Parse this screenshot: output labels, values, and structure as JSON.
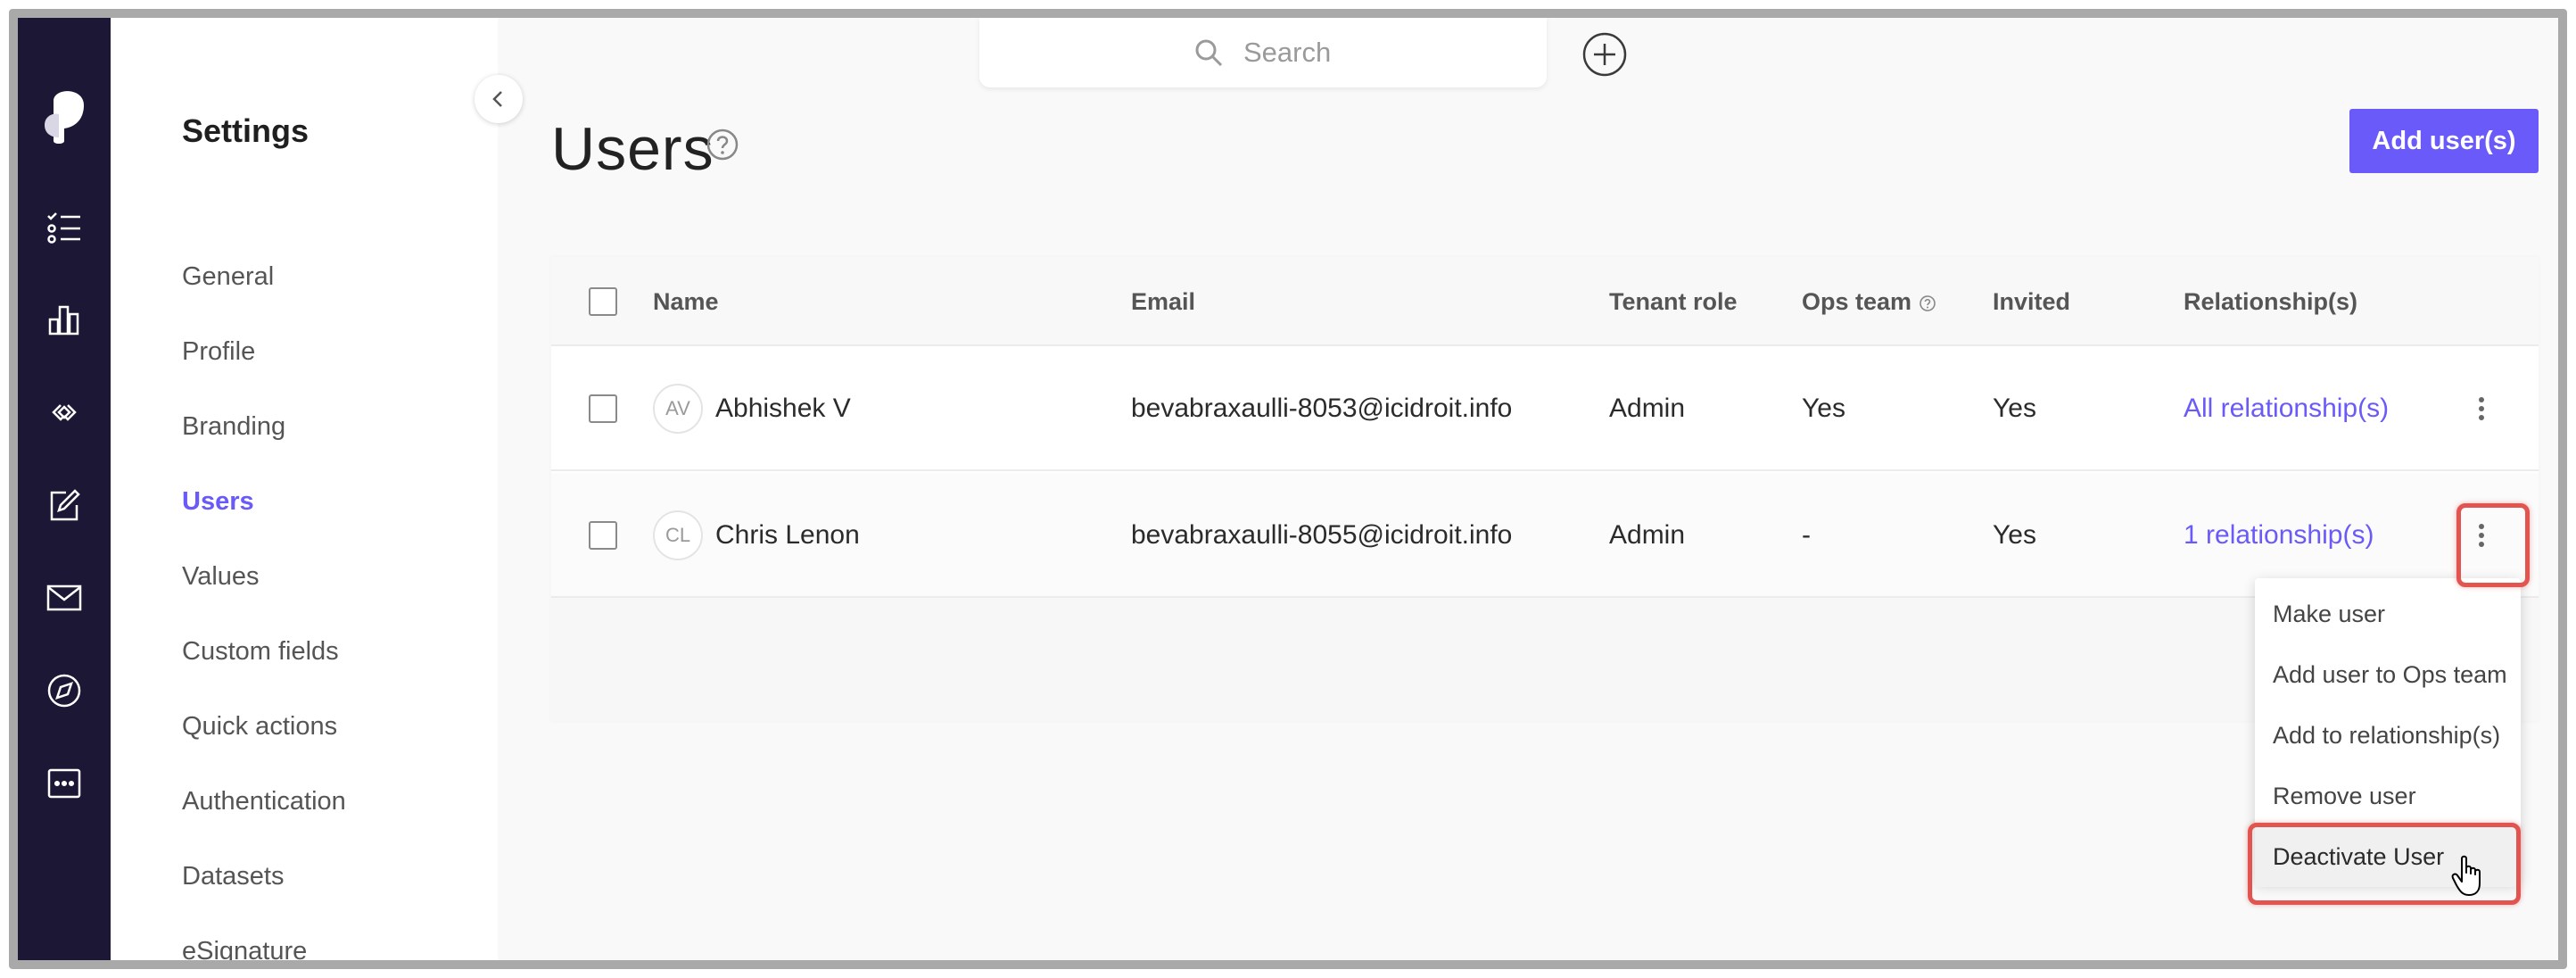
{
  "settings": {
    "title": "Settings",
    "menu": [
      {
        "label": "General",
        "active": false
      },
      {
        "label": "Profile",
        "active": false
      },
      {
        "label": "Branding",
        "active": false
      },
      {
        "label": "Users",
        "active": true
      },
      {
        "label": "Values",
        "active": false
      },
      {
        "label": "Custom fields",
        "active": false
      },
      {
        "label": "Quick actions",
        "active": false
      },
      {
        "label": "Authentication",
        "active": false
      },
      {
        "label": "Datasets",
        "active": false
      },
      {
        "label": "eSignature",
        "active": false
      }
    ]
  },
  "rail": {
    "icons": [
      "logo-icon",
      "checklist-icon",
      "bar-chart-icon",
      "link-icon",
      "edit-icon",
      "mail-icon",
      "compass-icon",
      "more-icon"
    ]
  },
  "search": {
    "placeholder": "Search"
  },
  "page": {
    "title": "Users",
    "add_button": "Add user(s)"
  },
  "table": {
    "columns": {
      "name": "Name",
      "email": "Email",
      "tenant_role": "Tenant role",
      "ops_team": "Ops team",
      "invited": "Invited",
      "relationships": "Relationship(s)"
    },
    "rows": [
      {
        "initials": "AV",
        "name": "Abhishek V",
        "email": "bevabraxaulli-8053@icidroit.info",
        "tenant_role": "Admin",
        "ops_team": "Yes",
        "invited": "Yes",
        "relationships": "All relationship(s)"
      },
      {
        "initials": "CL",
        "name": "Chris Lenon",
        "email": "bevabraxaulli-8055@icidroit.info",
        "tenant_role": "Admin",
        "ops_team": "-",
        "invited": "Yes",
        "relationships": "1 relationship(s)"
      }
    ]
  },
  "dropdown": {
    "items": [
      "Make user",
      "Add user to Ops team",
      "Add to relationship(s)",
      "Remove user",
      "Deactivate User"
    ]
  },
  "colors": {
    "accent": "#6a5af9",
    "rail": "#1d1736",
    "highlight": "#e2544f"
  }
}
